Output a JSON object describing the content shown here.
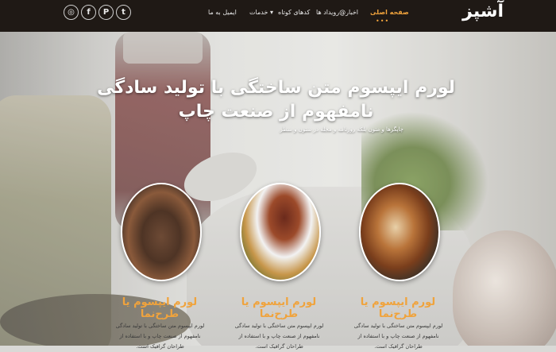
{
  "brand": {
    "logo_text": "آشپز"
  },
  "social": [
    {
      "icon": "dribbble-icon",
      "glyph": "◎"
    },
    {
      "icon": "facebook-icon",
      "glyph": "f"
    },
    {
      "icon": "pinterest-icon",
      "glyph": "P"
    },
    {
      "icon": "twitter-icon",
      "glyph": "t"
    }
  ],
  "nav": {
    "items": [
      {
        "label": "صفحه اصلی",
        "active": true
      },
      {
        "label": "اخبار@رویداد ها",
        "active": false
      },
      {
        "label": "کدهای کوتاه",
        "active": false
      },
      {
        "label": "خدمات",
        "active": false,
        "dropdown": true
      },
      {
        "label": "ایمیل به ما",
        "active": false
      }
    ],
    "active_indicator": "•••",
    "dropdown_glyph": "▾"
  },
  "hero": {
    "title": "لورم ایپسوم متن ساختگی با تولید سادگی نامفهوم از صنعت چاپ",
    "subtitle": "چاپگرها و متون بلکه روزنامه و مجله در ستون و سطر"
  },
  "cards": [
    {
      "title": "لورم ایپسوم یا طرح‌نما",
      "text": "لورم ایپسوم متن ساختگی با تولید سادگی نامفهوم از صنعت چاپ و با استفاده از طراحان گرافیک است."
    },
    {
      "title": "لورم ایپسوم یا طرح‌نما",
      "text": "لورم ایپسوم متن ساختگی با تولید سادگی نامفهوم از صنعت چاپ و با استفاده از طراحان گرافیک است."
    },
    {
      "title": "لورم ایپسوم یا طرح‌نما",
      "text": "لورم ایپسوم متن ساختگی با تولید سادگی نامفهوم از صنعت چاپ و با استفاده از طراحان گرافیک است."
    }
  ],
  "colors": {
    "navbar_bg": "#1f1915",
    "accent": "#f0a33c",
    "hero_text": "#ffffff"
  }
}
